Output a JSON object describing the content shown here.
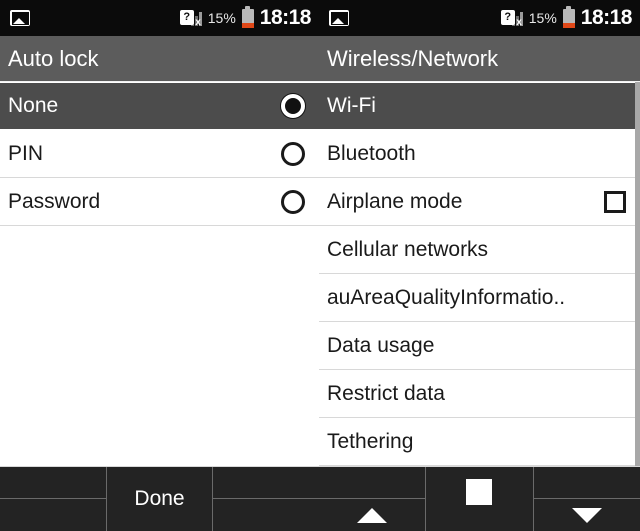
{
  "status_bar": {
    "gallery_icon": "gallery-icon",
    "signal_icon": "signal-unknown-icon",
    "signal_glyph": "?",
    "signal_x": "x",
    "battery_percent": "15%",
    "battery_icon": "battery-low-icon",
    "clock": "18:18"
  },
  "left_panel": {
    "title": "Auto lock",
    "rows": [
      {
        "label": "None",
        "control": "radio",
        "selected": true,
        "checked": true
      },
      {
        "label": "PIN",
        "control": "radio",
        "selected": false,
        "checked": false
      },
      {
        "label": "Password",
        "control": "radio",
        "selected": false,
        "checked": false
      }
    ],
    "softkeys": [
      {
        "label": "",
        "icon": ""
      },
      {
        "label": "Done",
        "icon": ""
      },
      {
        "label": "",
        "icon": ""
      }
    ]
  },
  "right_panel": {
    "title": "Wireless/Network",
    "rows": [
      {
        "label": "Wi-Fi",
        "control": "none",
        "selected": true
      },
      {
        "label": "Bluetooth",
        "control": "none",
        "selected": false
      },
      {
        "label": "Airplane mode",
        "control": "checkbox",
        "selected": false,
        "checked": false
      },
      {
        "label": "Cellular networks",
        "control": "none",
        "selected": false
      },
      {
        "label": "auAreaQualityInformatio..",
        "control": "none",
        "selected": false
      },
      {
        "label": "Data usage",
        "control": "none",
        "selected": false
      },
      {
        "label": "Restrict data",
        "control": "none",
        "selected": false
      },
      {
        "label": "Tethering",
        "control": "none",
        "selected": false
      }
    ],
    "scrollbar": {
      "visible": true
    },
    "softkeys": [
      {
        "label": "",
        "icon": "triangle-up-icon"
      },
      {
        "label": "",
        "icon": "square-stop-icon"
      },
      {
        "label": "",
        "icon": "triangle-down-icon"
      }
    ]
  },
  "colors": {
    "titlebar_bg": "#5c5c5c",
    "selected_row_bg": "#4c4c4c",
    "statusbar_bg": "#0b0b0b",
    "softkey_bg": "#232323",
    "battery_low": "#e04818",
    "divider": "#d8d8d8"
  }
}
